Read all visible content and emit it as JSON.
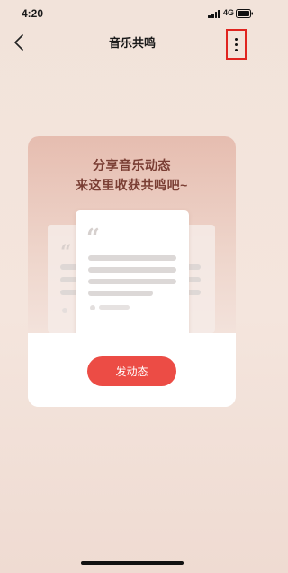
{
  "status_bar": {
    "time": "4:20",
    "network": "4G",
    "icons": [
      "signal-icon",
      "battery-icon"
    ]
  },
  "nav": {
    "title": "音乐共鸣",
    "back_icon": "chevron-left-icon",
    "more_icon": "more-vertical-icon",
    "highlight_color": "#e0241f"
  },
  "promo": {
    "line1": "分享音乐动态",
    "line2": "来这里收获共鸣吧~",
    "illustration_icon": "quote-icon",
    "button_label": "发动态",
    "button_color": "#ec4c45",
    "text_color": "#7a3e34"
  }
}
